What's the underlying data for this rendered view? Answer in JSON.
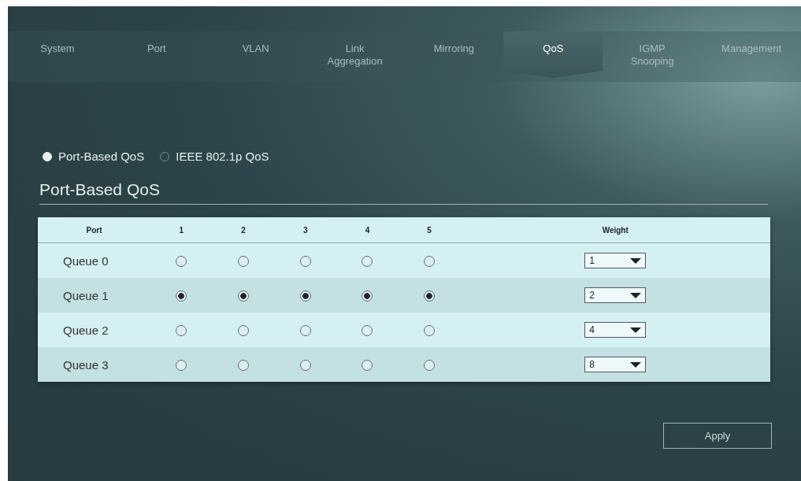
{
  "tabs": [
    {
      "label": "System",
      "selected": false
    },
    {
      "label": "Port",
      "selected": false
    },
    {
      "label": "VLAN",
      "selected": false
    },
    {
      "label": "Link Aggregation",
      "selected": false
    },
    {
      "label": "Mirroring",
      "selected": false
    },
    {
      "label": "QoS",
      "selected": true
    },
    {
      "label": "IGMP Snooping",
      "selected": false
    },
    {
      "label": "Management",
      "selected": false
    }
  ],
  "mode_options": [
    {
      "label": "Port-Based QoS",
      "selected": true
    },
    {
      "label": "IEEE 802.1p QoS",
      "selected": false
    }
  ],
  "section_title": "Port-Based QoS",
  "table": {
    "columns": [
      "Port",
      "1",
      "2",
      "3",
      "4",
      "5",
      "Weight"
    ],
    "rows": [
      {
        "queue": "Queue 0",
        "ports": [
          false,
          false,
          false,
          false,
          false
        ],
        "weight": "1"
      },
      {
        "queue": "Queue 1",
        "ports": [
          true,
          true,
          true,
          true,
          true
        ],
        "weight": "2"
      },
      {
        "queue": "Queue 2",
        "ports": [
          false,
          false,
          false,
          false,
          false
        ],
        "weight": "4"
      },
      {
        "queue": "Queue 3",
        "ports": [
          false,
          false,
          false,
          false,
          false
        ],
        "weight": "8"
      }
    ]
  },
  "apply_button": "Apply"
}
